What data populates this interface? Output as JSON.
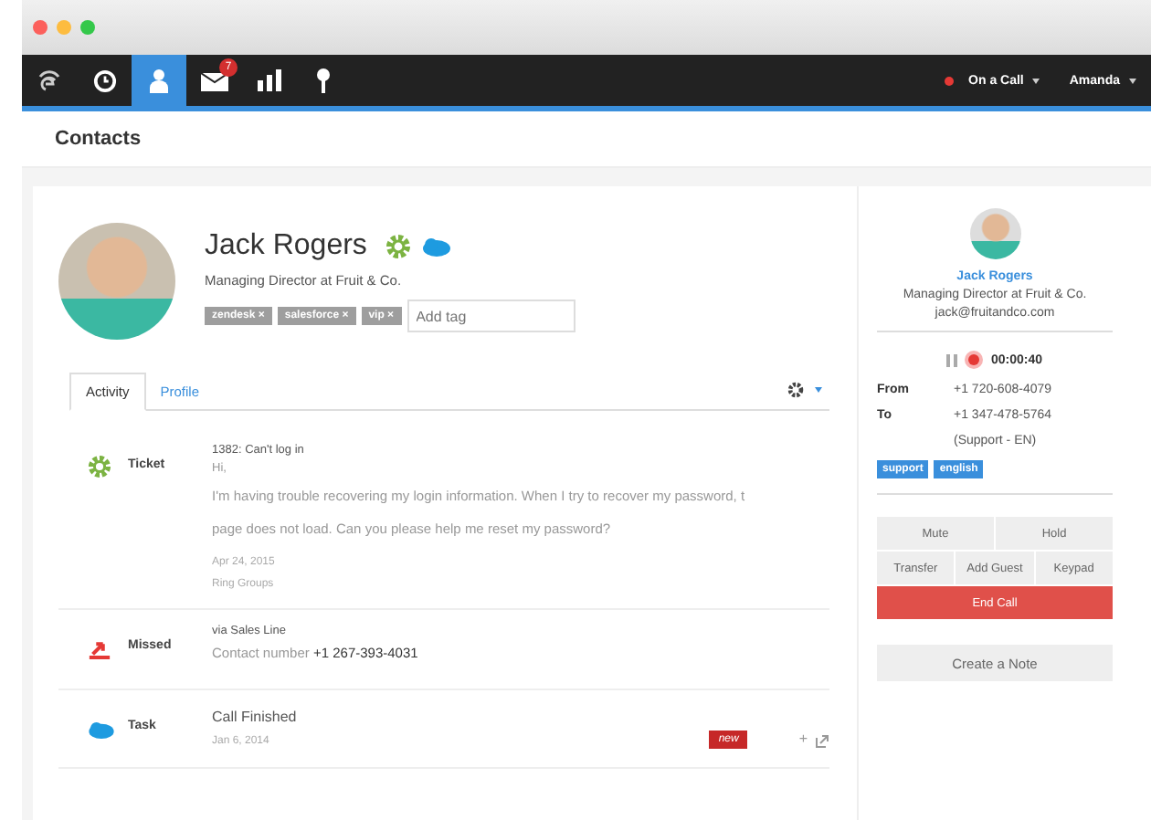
{
  "navbar": {
    "items": [
      {
        "kind": "logo",
        "selected": false
      },
      {
        "kind": "clock",
        "selected": false
      },
      {
        "kind": "contacts",
        "selected": true
      },
      {
        "kind": "inbox",
        "selected": false,
        "badge": "7"
      },
      {
        "kind": "stats",
        "selected": false
      },
      {
        "kind": "pin",
        "selected": false
      }
    ],
    "status": {
      "label": "On a Call",
      "color": "#e53935"
    },
    "user": "Amanda"
  },
  "page_title": "Contacts",
  "contact": {
    "name": "Jack Rogers",
    "title": "Managing Director at Fruit & Co.",
    "tags": [
      {
        "label": "zendesk",
        "remove": "×"
      },
      {
        "label": "salesforce",
        "remove": "×"
      },
      {
        "label": "vip",
        "remove": "×"
      }
    ],
    "tag_placeholder": "Add tag"
  },
  "tabs": [
    {
      "label": "Activity",
      "selected": true
    },
    {
      "label": "Profile",
      "selected": false
    }
  ],
  "activities": [
    {
      "kind": "ticket",
      "label": "Ticket",
      "title": "1382: Can't log in",
      "lines": [
        "Hi,",
        "I'm having trouble recovering my login information. When I try to recover my password, t",
        "page does not load. Can you please help me reset my password?"
      ],
      "date": "Apr 24, 2015",
      "footer": "Ring Groups"
    },
    {
      "kind": "missed",
      "label": "Missed",
      "title": "via Sales Line",
      "contact_label": "Contact number",
      "contact_value": "+1 267-393-4031"
    },
    {
      "kind": "task",
      "label": "Task",
      "title": "Call Finished",
      "date": "Jan 6, 2014",
      "badge": "new",
      "action": "+"
    }
  ],
  "call_panel": {
    "name": "Jack Rogers",
    "title": "Managing Director at Fruit & Co.",
    "email": "jack@fruitandco.com",
    "timer": "00:00:40",
    "rows": [
      {
        "label": "From",
        "value": "+1 720-608-4079"
      },
      {
        "label": "To",
        "value": "+1 347-478-5764"
      }
    ],
    "note": "(Support - EN)",
    "tags": [
      "support",
      "english"
    ],
    "button_rows": [
      [
        "Mute",
        "Hold"
      ],
      [
        "Transfer",
        "Add Guest",
        "Keypad"
      ]
    ],
    "end_call": "End Call",
    "create_note": "Create a Note"
  }
}
